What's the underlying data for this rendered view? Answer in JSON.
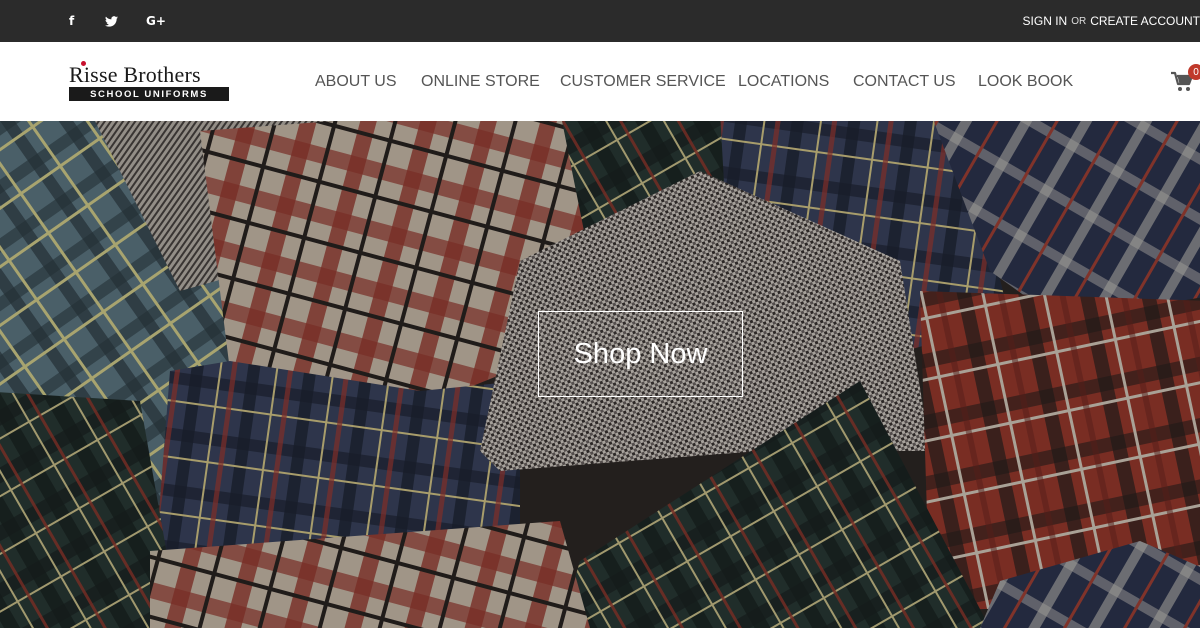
{
  "topbar": {
    "social": {
      "facebook": {
        "icon": "facebook-icon",
        "glyph": "f"
      },
      "twitter": {
        "icon": "twitter-icon",
        "glyph": "🐦"
      },
      "googleplus": {
        "icon": "google-plus-icon",
        "glyph": "G+"
      }
    },
    "sign_in": "SIGN IN",
    "or": "OR",
    "create_account": "CREATE ACCOUNT"
  },
  "header": {
    "logo": {
      "name": "Risse Brothers",
      "tagline": "SCHOOL UNIFORMS"
    },
    "nav": [
      {
        "label": "ABOUT US"
      },
      {
        "label": "ONLINE STORE"
      },
      {
        "label": "CUSTOMER SERVICE"
      },
      {
        "label": "LOCATIONS"
      },
      {
        "label": "CONTACT US"
      },
      {
        "label": "LOOK BOOK"
      }
    ],
    "cart": {
      "icon": "shopping-cart-icon",
      "count": "0"
    }
  },
  "hero": {
    "background": "plaid-fabric-swatches",
    "cta_label": "Shop Now"
  },
  "colors": {
    "topbar_bg": "#2b2b2b",
    "nav_text": "#555555",
    "badge": "#c0392b"
  }
}
